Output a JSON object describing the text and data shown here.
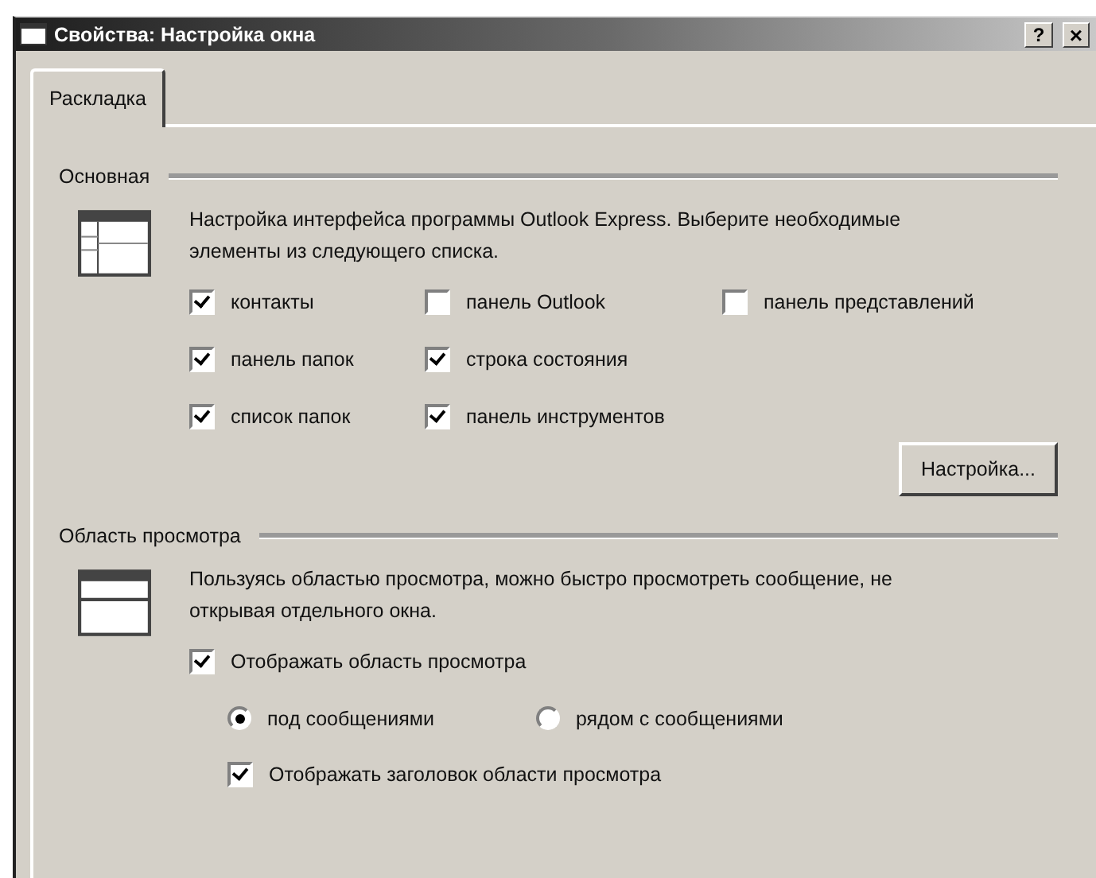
{
  "window": {
    "title": "Свойства: Настройка окна",
    "buttons": [
      {
        "kind": "help",
        "label": "?"
      },
      {
        "kind": "close",
        "label": "×"
      }
    ]
  },
  "tabs": [
    {
      "label": "Раскладка",
      "selected": true
    }
  ],
  "sections": [
    {
      "kind": "grid",
      "title": "Основная",
      "description": "Настройка интерфейса программы Outlook Express. Выберите необходимые элементы из следующего списка.",
      "rows": [
        [
          {
            "label": "контакты",
            "checked": true
          },
          {
            "label": "панель Outlook",
            "checked": false
          },
          {
            "label": "панель представлений",
            "checked": false
          }
        ],
        [
          {
            "label": "панель папок",
            "checked": true
          },
          {
            "label": "строка состояния",
            "checked": true
          }
        ],
        [
          {
            "label": "список папок",
            "checked": true
          },
          {
            "label": "панель инструментов",
            "checked": true
          }
        ]
      ],
      "button": "Настройка..."
    },
    {
      "kind": "tree",
      "title": "Область просмотра",
      "description": "Пользуясь областью просмотра, можно быстро просмотреть сообщение, не открывая отдельного окна.",
      "options": [
        {
          "kind": "checkbox",
          "label": "Отображать область просмотра",
          "checked": true,
          "children": [
            {
              "kind": "radio_group",
              "options": [
                {
                  "label": "под сообщениями",
                  "selected": true
                },
                {
                  "label": "рядом с сообщениями",
                  "selected": false
                }
              ]
            },
            {
              "kind": "checkbox",
              "label": "Отображать заголовок области просмотра",
              "checked": true
            }
          ]
        }
      ]
    }
  ]
}
